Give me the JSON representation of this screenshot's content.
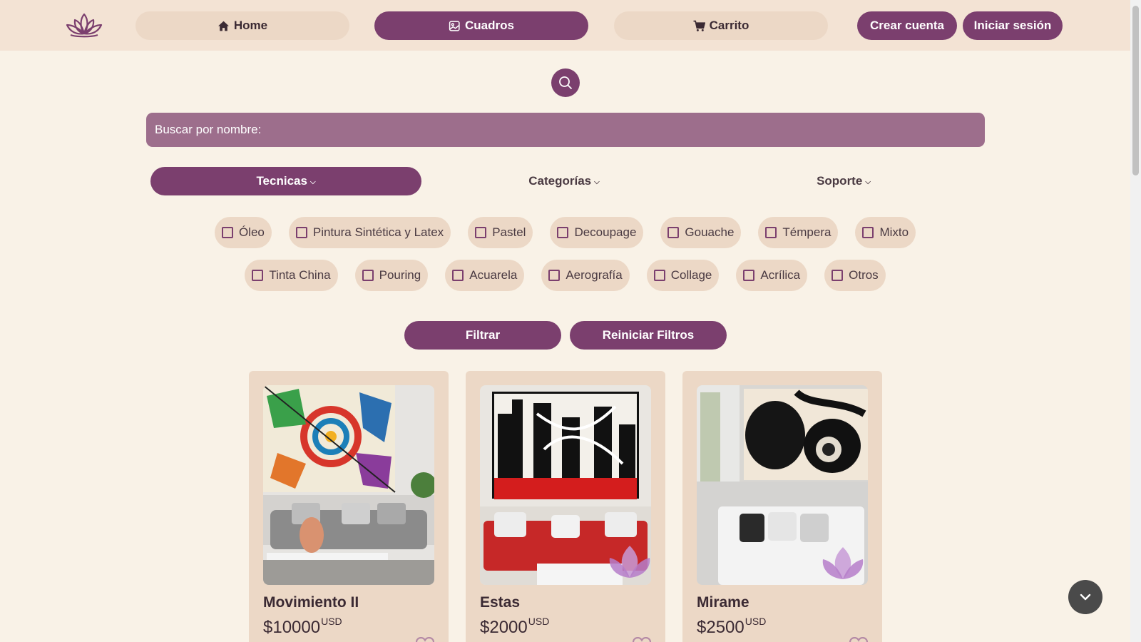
{
  "nav": {
    "home_label": "Home",
    "cuadros_label": "Cuadros",
    "carrito_label": "Carrito",
    "crear_cuenta_label": "Crear cuenta",
    "iniciar_sesion_label": "Iniciar sesión"
  },
  "search": {
    "placeholder": "Buscar por nombre:"
  },
  "filter_tabs": {
    "tecnicas": "Tecnicas",
    "categorias": "Categorías",
    "soporte": "Soporte",
    "active": "Tecnicas"
  },
  "techniques_row1": [
    "Óleo",
    "Pintura Sintética y Latex",
    "Pastel",
    "Decoupage",
    "Gouache",
    "Témpera",
    "Mixto"
  ],
  "techniques_row2": [
    "Tinta China",
    "Pouring",
    "Acuarela",
    "Aerografía",
    "Collage",
    "Acrílica",
    "Otros"
  ],
  "actions": {
    "filtrar": "Filtrar",
    "reiniciar": "Reiniciar Filtros"
  },
  "products": [
    {
      "title": "Movimiento II",
      "price": "$10000",
      "currency": "USD"
    },
    {
      "title": "Estas",
      "price": "$2000",
      "currency": "USD"
    },
    {
      "title": "Mirame",
      "price": "$2500",
      "currency": "USD"
    }
  ],
  "colors": {
    "accent": "#7b3f6e",
    "header_bg": "#f3e3d4",
    "page_bg": "#f9f2e7",
    "chip_bg": "#ecd8c6",
    "search_bg": "#9d6e8c"
  },
  "icons": [
    "lotus-logo-icon",
    "home-icon",
    "image-icon",
    "cart-icon",
    "search-icon",
    "chevron-down-icon",
    "heart-icon"
  ]
}
